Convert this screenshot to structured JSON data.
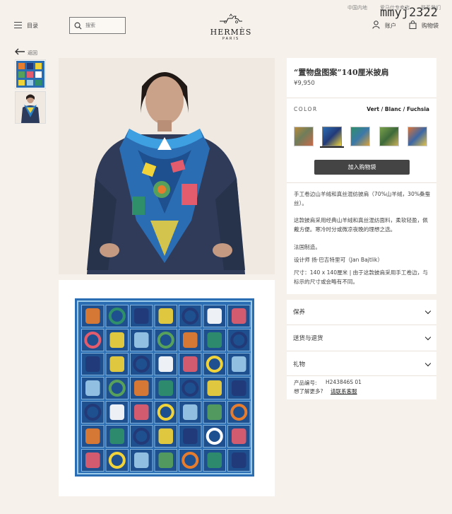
{
  "header": {
    "region": "中国内地",
    "account_top": "爱马仕专卖店",
    "contact_top": "联系我们",
    "menu_label": "目录",
    "search_placeholder": "搜索",
    "logo_name": "HERMÈS",
    "logo_city": "PARIS",
    "account_label": "账户",
    "cart_label": "购物袋"
  },
  "watermark": "mmyj2322",
  "nav": {
    "back_label": "返回"
  },
  "product": {
    "title": "“置物盘图案”140厘米披肩",
    "price": "¥9,950",
    "color_label": "COLOR",
    "color_value": "Vert / Blanc / Fuchsia",
    "add_to_bag": "加入购物袋",
    "description": [
      "手工卷边山羊绒和真丝混纺披肩（70%山羊绒，30%桑蚕丝）。",
      "这款披肩采用经典山羊绒和真丝混纺面料，柔软轻盈，佩戴方便。寒冷时分或微凉夜晚的理想之选。",
      "法国制造。",
      "设计师 扬·巴吉特里可（Jan Bajtlik）",
      "尺寸：140 x 140厘米 | 由于这款披肩采用手工卷边，与标示的尺寸或会略有不同。"
    ],
    "accordion": [
      "保养",
      "送货与退货",
      "礼物"
    ],
    "product_code_label": "产品编号:",
    "product_code": "H243846S 01",
    "more_info": "想了解更多?",
    "contact_advisor": "请联系客服"
  },
  "colors": {
    "background": "#f6f1eb",
    "button": "#444444",
    "scarf_blue": "#2b6db3",
    "scarf_navy": "#223a78"
  }
}
